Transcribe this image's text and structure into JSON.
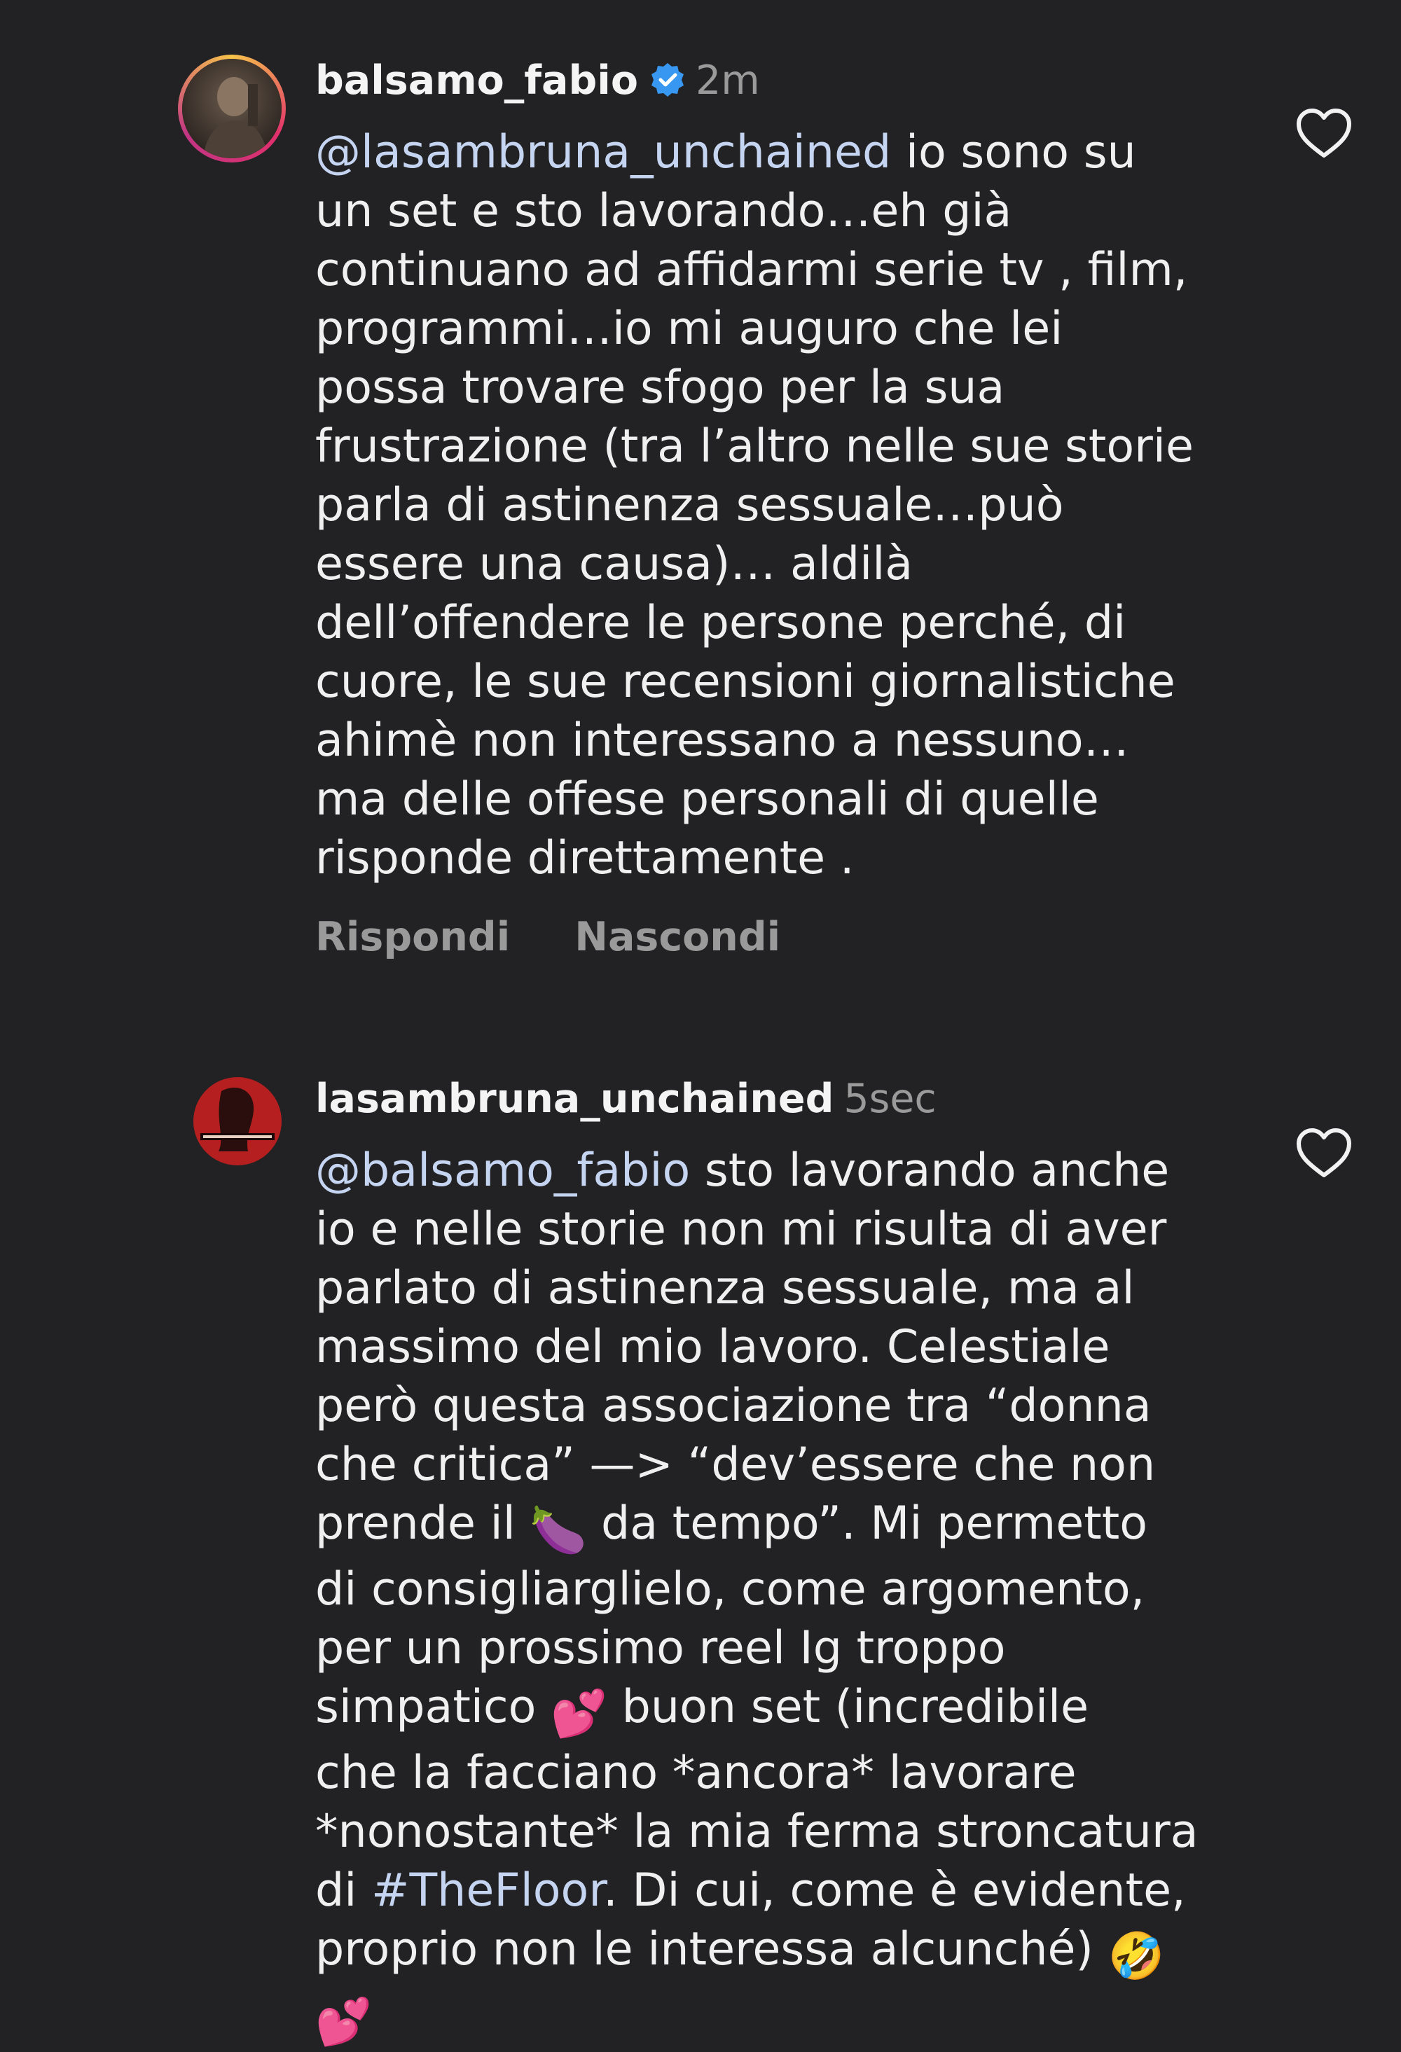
{
  "comments": [
    {
      "username": "balsamo_fabio",
      "verified": true,
      "time": "2m",
      "mention": "@lasambruna_unchained",
      "lines": {
        "l1": " io sono su",
        "l2": "un set e sto lavorando…eh già",
        "l3": "continuano ad affidarmi serie tv , film,",
        "l4": "programmi…io mi auguro che lei",
        "l5": "possa trovare sfogo per la sua",
        "l6": "frustrazione (tra l’altro nelle sue storie",
        "l7": "parla di astinenza sessuale…può",
        "l8": "essere una causa)… aldilà",
        "l9": "dell’offendere le persone perché, di",
        "l10": "cuore, le sue recensioni giornalistiche",
        "l11": "ahimè non interessano a nessuno…",
        "l12": "ma delle offese personali di quelle",
        "l13": "risponde direttamente ."
      },
      "reply_label": "Rispondi",
      "hide_label": "Nascondi"
    },
    {
      "username": "lasambruna_unchained",
      "verified": false,
      "time": "5sec",
      "mention": "@balsamo_fabio",
      "lines": {
        "l1": " sto lavorando anche",
        "l2": "io e nelle storie non mi risulta di aver",
        "l3": "parlato di astinenza sessuale, ma al",
        "l4": "massimo del mio lavoro. Celestiale",
        "l5": "però questa associazione tra “donna",
        "l6": "che critica” —> “dev’essere che non",
        "l7a": "prende il ",
        "l7b": " da tempo”. Mi permetto",
        "l8": "di consigliarglielo, come argomento,",
        "l9": "per un prossimo reel Ig troppo",
        "l10a": "simpatico ",
        "l10b": " buon set (incredibile",
        "l11": "che la facciano *ancora* lavorare",
        "l12": "*nonostante* la mia ferma stroncatura",
        "l13a": "di ",
        "l13_hashtag": "#TheFloor",
        "l13b": ". Di cui, come è evidente,",
        "l14": "proprio non le interessa alcunché) "
      },
      "emojis": {
        "eggplant": "🍆",
        "two_hearts": "💕",
        "rofl": "🤣"
      }
    }
  ],
  "icons": {
    "heart": "heart-icon",
    "verified": "verified-badge-icon"
  },
  "colors": {
    "background": "#222224",
    "text": "#f0f0f0",
    "secondary": "#9a9a9a",
    "mention": "#c5d4f0",
    "verified": "#3897f0"
  }
}
